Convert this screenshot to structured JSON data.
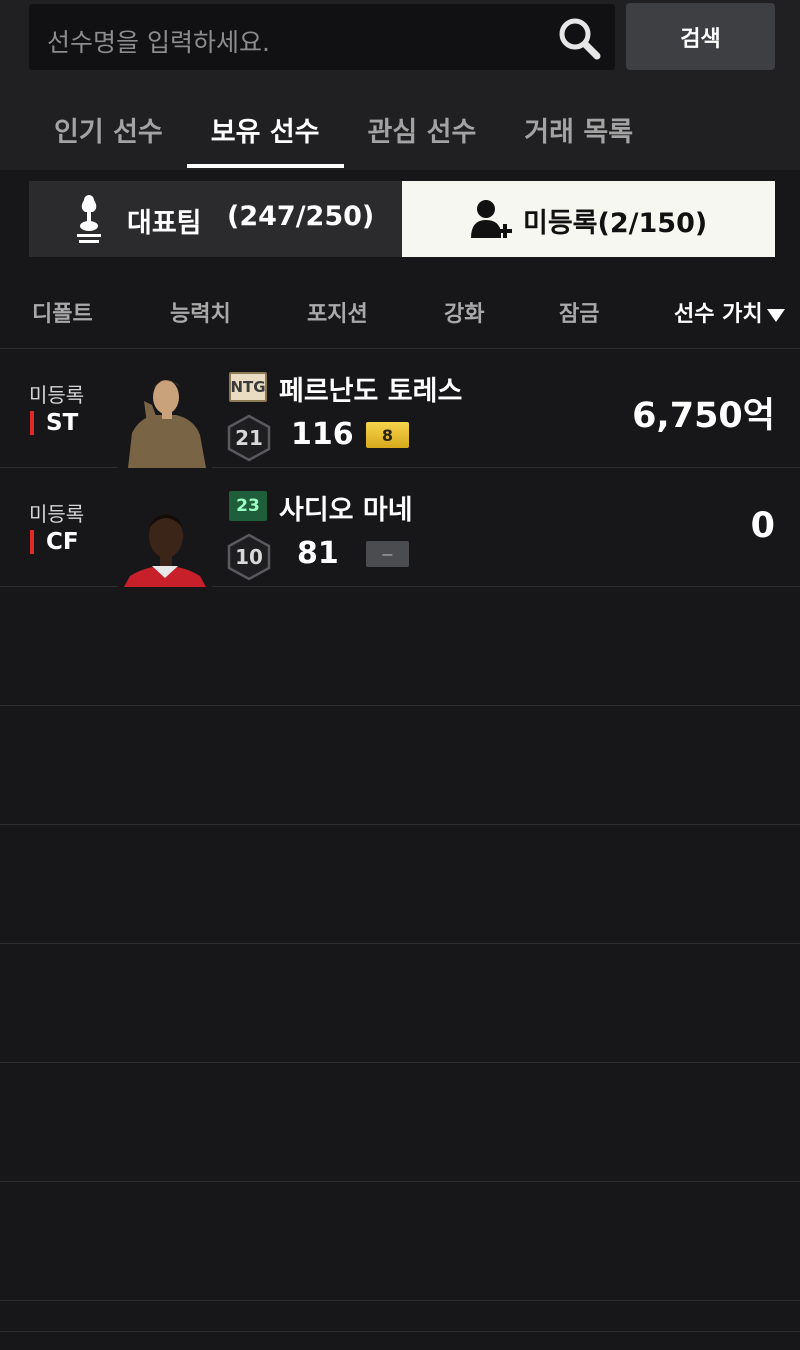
{
  "search": {
    "placeholder": "선수명을 입력하세요.",
    "button_label": "검색"
  },
  "tabs": [
    {
      "label": "인기 선수",
      "active": false
    },
    {
      "label": "보유 선수",
      "active": true
    },
    {
      "label": "관심 선수",
      "active": false
    },
    {
      "label": "거래 목록",
      "active": false
    }
  ],
  "team": {
    "name": "대표팀",
    "count": "(247/250)",
    "unregistered_label": "미등록(2/150)"
  },
  "sort_options": [
    "디폴트",
    "능력치",
    "포지션",
    "강화",
    "잠금",
    "선수 가치"
  ],
  "active_sort": "선수 가치",
  "players": [
    {
      "status": "미등록",
      "position": "ST",
      "season": "NTG",
      "name": "페르난도 토레스",
      "grade": "21",
      "ovr": "116",
      "enhance": "8",
      "price": "6,750억"
    },
    {
      "status": "미등록",
      "position": "CF",
      "season": "23",
      "name": "사디오 마네",
      "grade": "10",
      "ovr": "81",
      "enhance": "−",
      "price": "0"
    }
  ],
  "colors": {
    "position_marker": "#e02a2a",
    "enhance_gold": "#f0c93a",
    "season_23": "#1f5e3a"
  }
}
